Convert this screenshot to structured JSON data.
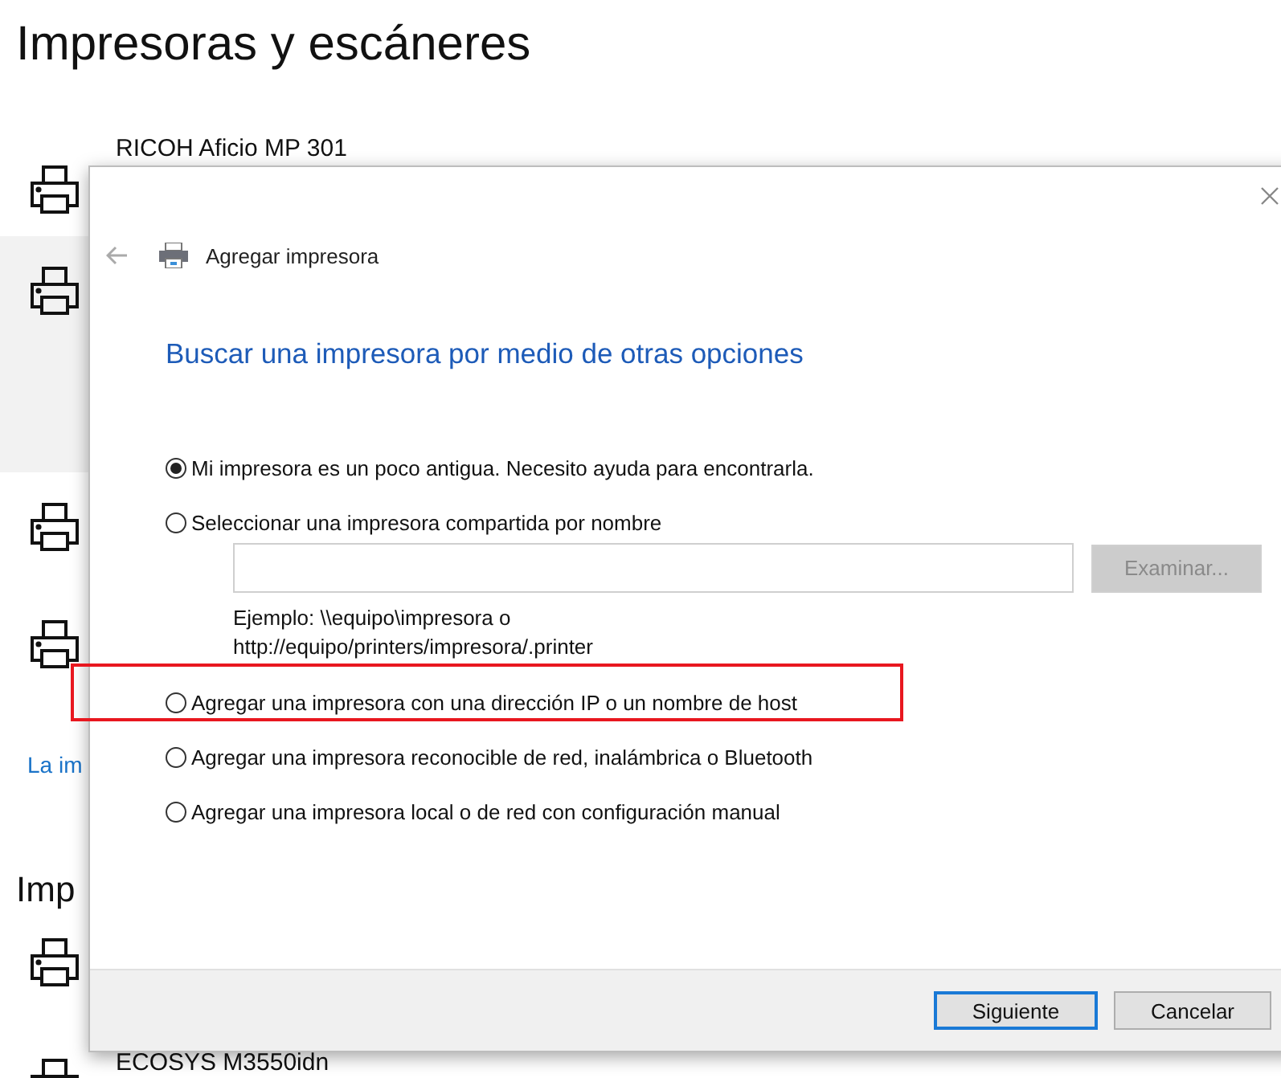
{
  "page": {
    "title": "Impresoras y escáneres",
    "printers": [
      {
        "name": "RICOH Aficio MP 301",
        "selected": false
      },
      {
        "selected": true
      },
      {
        "selected": false
      },
      {
        "selected": false
      }
    ],
    "link": "La im",
    "section_heading": "Imp",
    "more_printers": [
      {
        "selected": false
      },
      {
        "name": "ECOSYS M3550idn",
        "selected": false
      }
    ]
  },
  "dialog": {
    "title": "Agregar impresora",
    "heading": "Buscar una impresora por medio de otras opciones",
    "options": [
      {
        "label": "Mi impresora es un poco antigua. Necesito ayuda para encontrarla.",
        "selected": true,
        "highlighted": false
      },
      {
        "label": "Seleccionar una impresora compartida por nombre",
        "selected": false,
        "highlighted": false,
        "kind": "shared"
      },
      {
        "label": "Agregar una impresora con una dirección IP o un nombre de host",
        "selected": false,
        "highlighted": true
      },
      {
        "label": "Agregar una impresora reconocible de red, inalámbrica o Bluetooth",
        "selected": false,
        "highlighted": false
      },
      {
        "label": "Agregar una impresora local o de red con configuración manual",
        "selected": false,
        "highlighted": false
      }
    ],
    "browse_button": {
      "label": "Examinar...",
      "disabled": true
    },
    "example": [
      "Ejemplo: \\\\equipo\\impresora o",
      "http://equipo/printers/impresora/.printer"
    ],
    "buttons": [
      {
        "label": "Siguiente",
        "default": true
      },
      {
        "label": "Cancelar",
        "default": false
      }
    ]
  }
}
